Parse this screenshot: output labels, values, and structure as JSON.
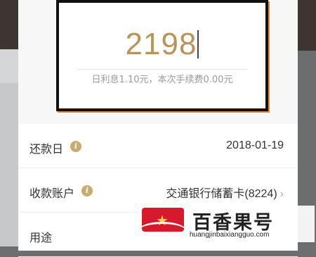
{
  "amount": {
    "value": "2198"
  },
  "interest_text": "日利息1.10元，本次手续费0.00元",
  "rows": [
    {
      "label": "还款日",
      "value": "2018-01-19"
    },
    {
      "label": "收款账户",
      "value": "交通银行储蓄卡(8224)"
    },
    {
      "label": "用途",
      "value": ""
    }
  ],
  "icons": {
    "info": "info-icon",
    "chevron": "chevron-right-icon"
  },
  "colors": {
    "accent": "#b8945a",
    "info_icon": "#c9ab72",
    "watermark_red": "#d7192e"
  },
  "watermark": {
    "name": "百香果号",
    "url": "huangjinbaixiangguo.com"
  }
}
